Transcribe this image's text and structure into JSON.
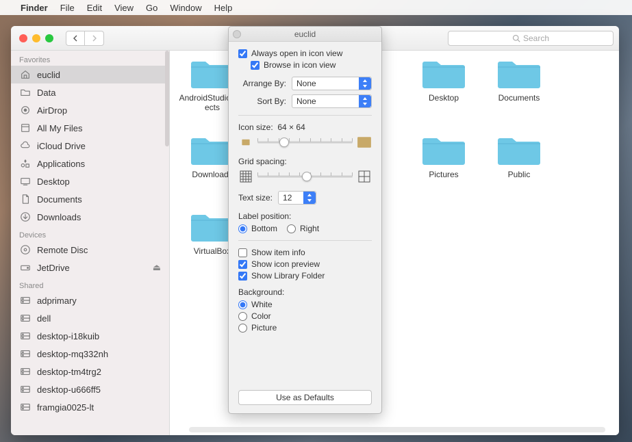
{
  "menubar": {
    "items": [
      "Finder",
      "File",
      "Edit",
      "View",
      "Go",
      "Window",
      "Help"
    ]
  },
  "finder": {
    "nav_back": "‹",
    "nav_fwd": "›",
    "search_placeholder": "Search"
  },
  "sidebar": {
    "sections": [
      {
        "title": "Favorites",
        "items": [
          {
            "icon": "home",
            "label": "euclid",
            "selected": true
          },
          {
            "icon": "folder",
            "label": "Data"
          },
          {
            "icon": "airdrop",
            "label": "AirDrop"
          },
          {
            "icon": "allfiles",
            "label": "All My Files"
          },
          {
            "icon": "cloud",
            "label": "iCloud Drive"
          },
          {
            "icon": "apps",
            "label": "Applications"
          },
          {
            "icon": "desktop",
            "label": "Desktop"
          },
          {
            "icon": "documents",
            "label": "Documents"
          },
          {
            "icon": "downloads",
            "label": "Downloads"
          }
        ]
      },
      {
        "title": "Devices",
        "items": [
          {
            "icon": "disc",
            "label": "Remote Disc"
          },
          {
            "icon": "drive",
            "label": "JetDrive",
            "eject": true
          }
        ]
      },
      {
        "title": "Shared",
        "items": [
          {
            "icon": "server",
            "label": "adprimary"
          },
          {
            "icon": "server",
            "label": "dell"
          },
          {
            "icon": "server",
            "label": "desktop-i18kuib"
          },
          {
            "icon": "server",
            "label": "desktop-mq332nh"
          },
          {
            "icon": "server",
            "label": "desktop-tm4trg2"
          },
          {
            "icon": "server",
            "label": "desktop-u666ff5"
          },
          {
            "icon": "server",
            "label": "framgia0025-lt"
          }
        ]
      }
    ]
  },
  "folders": [
    {
      "label": "AndroidStudioProjects"
    },
    {
      "label": "Desktop"
    },
    {
      "label": "Documents"
    },
    {
      "label": "Downloads"
    },
    {
      "label": "Pictures"
    },
    {
      "label": "Public"
    },
    {
      "label": "VirtualBox"
    }
  ],
  "panel": {
    "title": "euclid",
    "always_open": {
      "label": "Always open in icon view",
      "checked": true
    },
    "browse": {
      "label": "Browse in icon view",
      "checked": true
    },
    "arrange_by": {
      "label": "Arrange By:",
      "value": "None"
    },
    "sort_by": {
      "label": "Sort By:",
      "value": "None"
    },
    "icon_size": {
      "label": "Icon size:",
      "value": "64 × 64",
      "pos": 28
    },
    "grid_spacing": {
      "label": "Grid spacing:",
      "pos": 52
    },
    "text_size": {
      "label": "Text size:",
      "value": "12"
    },
    "label_position": {
      "label": "Label position:",
      "options": [
        "Bottom",
        "Right"
      ],
      "selected": "Bottom"
    },
    "show_item_info": {
      "label": "Show item info",
      "checked": false
    },
    "show_icon_preview": {
      "label": "Show icon preview",
      "checked": true
    },
    "show_library": {
      "label": "Show Library Folder",
      "checked": true
    },
    "background": {
      "label": "Background:",
      "options": [
        "White",
        "Color",
        "Picture"
      ],
      "selected": "White"
    },
    "defaults_btn": "Use as Defaults"
  }
}
